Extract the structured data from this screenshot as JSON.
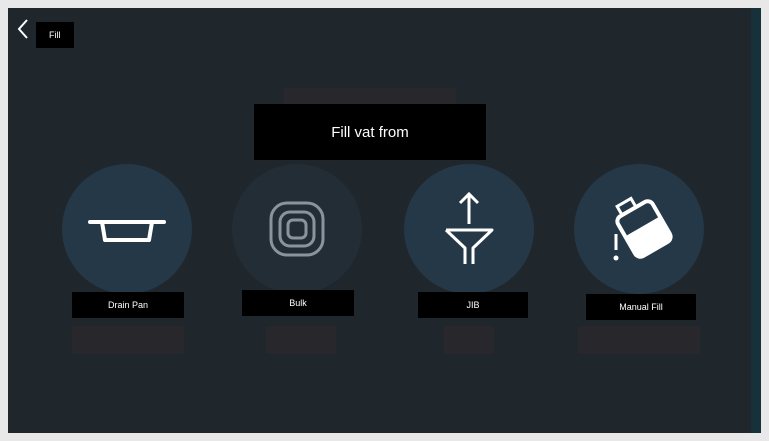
{
  "header": {
    "title": "Fill",
    "back_icon": "chevron-left-icon"
  },
  "prompt": "Fill vat from",
  "options": [
    {
      "label": "Drain Pan",
      "icon": "drain-pan-icon"
    },
    {
      "label": "Bulk",
      "icon": "bulk-container-icon"
    },
    {
      "label": "JIB",
      "icon": "funnel-icon"
    },
    {
      "label": "Manual Fill",
      "icon": "pour-jug-icon"
    }
  ],
  "colors": {
    "background": "#1f262c",
    "circle": "#253848",
    "circle_dim": "#222d36",
    "label_bg": "#000000",
    "text": "#ffffff"
  }
}
